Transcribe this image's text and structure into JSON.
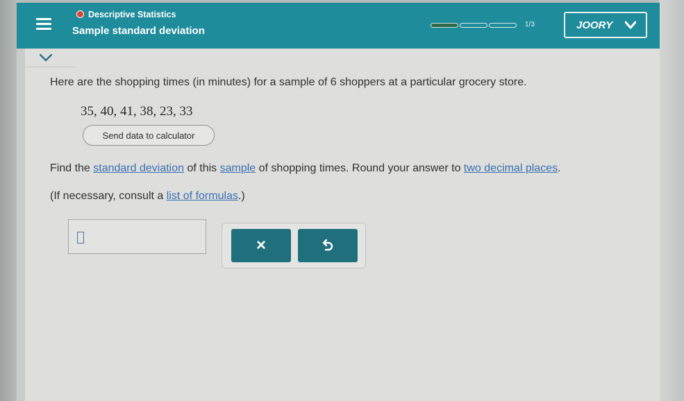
{
  "header": {
    "topic": "Descriptive Statistics",
    "title": "Sample standard deviation",
    "progress_text": "1/3",
    "progress_fraction": 0.33,
    "user_label": "JOORY",
    "accent_color": "#1f8c9c",
    "topic_dot_color": "#e2452f",
    "icons": {
      "menu": "hamburger-menu-icon",
      "user_dropdown": "chevron-down-icon",
      "collapse": "chevron-down-icon"
    }
  },
  "problem": {
    "intro": "Here are the shopping times (in minutes) for a sample of 6 shoppers at a particular grocery store.",
    "data_values": "35, 40, 41, 38, 23, 33",
    "send_button_label": "Send data to calculator",
    "find": {
      "prefix": "Find the ",
      "link1": "standard deviation",
      "middle1": " of this ",
      "link2": "sample",
      "middle2": " of shopping times. Round your answer to ",
      "link3": "two decimal places",
      "suffix": "."
    },
    "formulas": {
      "prefix": "(If necessary, consult a ",
      "link": "list of formulas",
      "suffix": ".)"
    }
  },
  "answer": {
    "value": "",
    "clear_label": "×",
    "undo_icon": "undo-icon",
    "button_color": "#1f6f7d"
  }
}
